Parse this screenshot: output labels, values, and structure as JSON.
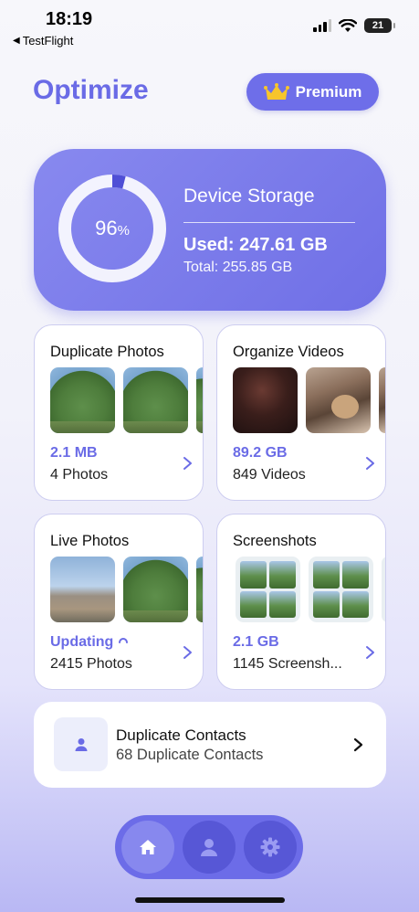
{
  "status_bar": {
    "time": "18:19",
    "back_app": "TestFlight",
    "battery": "21"
  },
  "header": {
    "title": "Optimize",
    "premium_label": "Premium"
  },
  "storage": {
    "percent": "96",
    "percent_sign": "%",
    "percent_value": 0.96,
    "title": "Device Storage",
    "used": "Used: 247.61 GB",
    "total": "Total: 255.85 GB"
  },
  "tiles": [
    {
      "title": "Duplicate Photos",
      "size": "2.1 MB",
      "count": "4 Photos"
    },
    {
      "title": "Organize Videos",
      "size": "89.2 GB",
      "count": "849 Videos"
    },
    {
      "title": "Live Photos",
      "size": "Updating",
      "count": "2415 Photos"
    },
    {
      "title": "Screenshots",
      "size": "2.1 GB",
      "count": "1145 Screensh..."
    }
  ],
  "contacts": {
    "title": "Duplicate Contacts",
    "subtitle": "68 Duplicate Contacts"
  },
  "tabbar": {
    "tabs": [
      {
        "icon": "home-icon",
        "active": true
      },
      {
        "icon": "person-icon",
        "active": false
      },
      {
        "icon": "gear-icon",
        "active": false
      }
    ]
  },
  "colors": {
    "accent": "#6a6be6",
    "card_gradient_start": "#8889ef",
    "card_gradient_end": "#6f6fe6"
  }
}
